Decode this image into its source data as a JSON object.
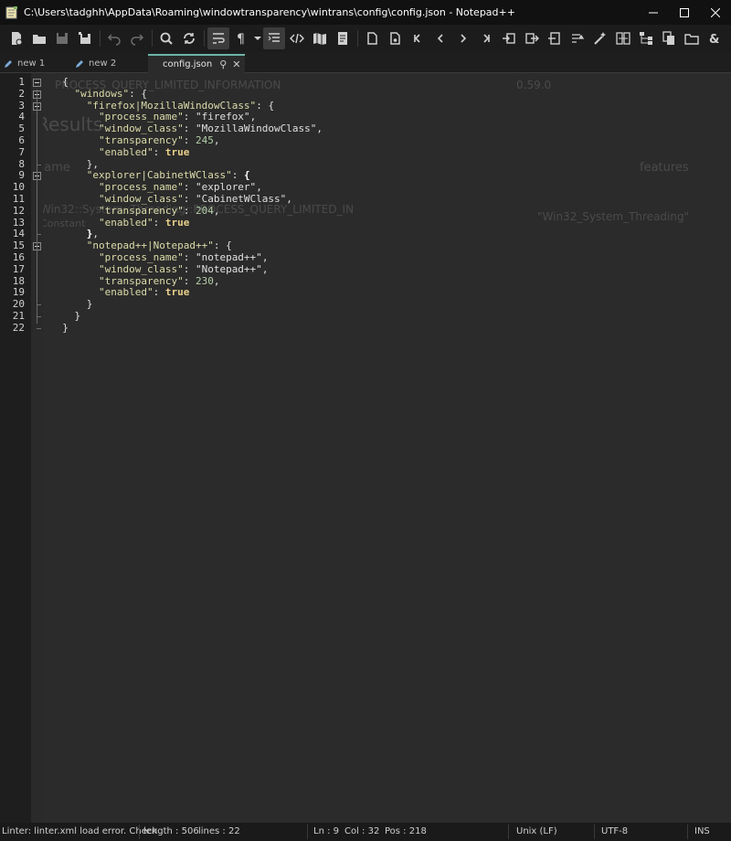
{
  "window": {
    "title": "C:\\Users\\tadghh\\AppData\\Roaming\\windowtransparency\\wintrans\\config\\config.json - Notepad++"
  },
  "tabs": [
    {
      "label": "new 1"
    },
    {
      "label": "new 2"
    },
    {
      "label": "config.json"
    }
  ],
  "ghost": {
    "filter": "PROCESS_QUERY_LIMITED_INFORMATION",
    "version": "0.59.0",
    "results": "Results",
    "name_col": "name",
    "features_col": "features",
    "row_name": "Win32::System::Threading::PROCESS_QUERY_LIMITED_IN",
    "row_sub": "Constant",
    "row_feature": "\"Win32_System_Threading\""
  },
  "code": {
    "line_numbers": [
      "1",
      "2",
      "3",
      "4",
      "5",
      "6",
      "7",
      "8",
      "9",
      "10",
      "11",
      "12",
      "13",
      "14",
      "15",
      "16",
      "17",
      "18",
      "19",
      "20",
      "21",
      "22"
    ],
    "entries": [
      {
        "key": "firefox|MozillaWindowClass",
        "process_name": "firefox",
        "window_class": "MozillaWindowClass",
        "transparency": "245",
        "enabled": "true"
      },
      {
        "key": "explorer|CabinetWClass",
        "process_name": "explorer",
        "window_class": "CabinetWClass",
        "transparency": "204",
        "enabled": "true"
      },
      {
        "key": "notepad++|Notepad++",
        "process_name": "notepad++",
        "window_class": "Notepad++",
        "transparency": "230",
        "enabled": "true"
      }
    ],
    "root_key": "windows",
    "field_names": {
      "process_name": "process_name",
      "window_class": "window_class",
      "transparency": "transparency",
      "enabled": "enabled"
    }
  },
  "status": {
    "message": "Linter: linter.xml load error. Check",
    "length": "length : 506",
    "lines": "lines : 22",
    "ln": "Ln : 9",
    "col": "Col : 32",
    "pos": "Pos : 218",
    "eol": "Unix (LF)",
    "encoding": "UTF-8",
    "mode": "INS"
  },
  "colors": {
    "accent_tab": "#6db5a8",
    "background": "#2b2b2b",
    "key": "#dcdcaa",
    "number": "#b5cea8"
  }
}
